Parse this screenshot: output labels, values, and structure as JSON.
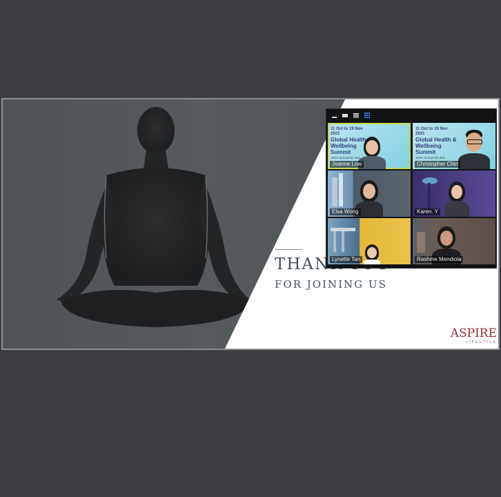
{
  "slide": {
    "title": "THANK YOU",
    "subtitle": "FOR JOINING US",
    "brand_name": "ASPIRE",
    "brand_sub": "LIFESTYLE"
  },
  "gallery": {
    "toolbar": [
      "minimize",
      "speaker-view",
      "strip-view",
      "gallery-view"
    ],
    "banner": {
      "dates": "11 Oct to 19 Nov 2021",
      "title": "Global Health & Wellbeing Summit",
      "tagline": "100% anonymity and..."
    },
    "participants": [
      {
        "name": "Joanne Low",
        "active": true
      },
      {
        "name": "Christopher Chin",
        "active": false
      },
      {
        "name": "Elsa Wong",
        "active": false
      },
      {
        "name": "Karen. Y",
        "active": false
      },
      {
        "name": "Lynette Tan",
        "active": false
      },
      {
        "name": "Rashme Mendiola",
        "active": false
      }
    ]
  },
  "colors": {
    "background": "#3c3d40",
    "accent_border": "#c7d84a",
    "brand": "#9a2b35"
  }
}
